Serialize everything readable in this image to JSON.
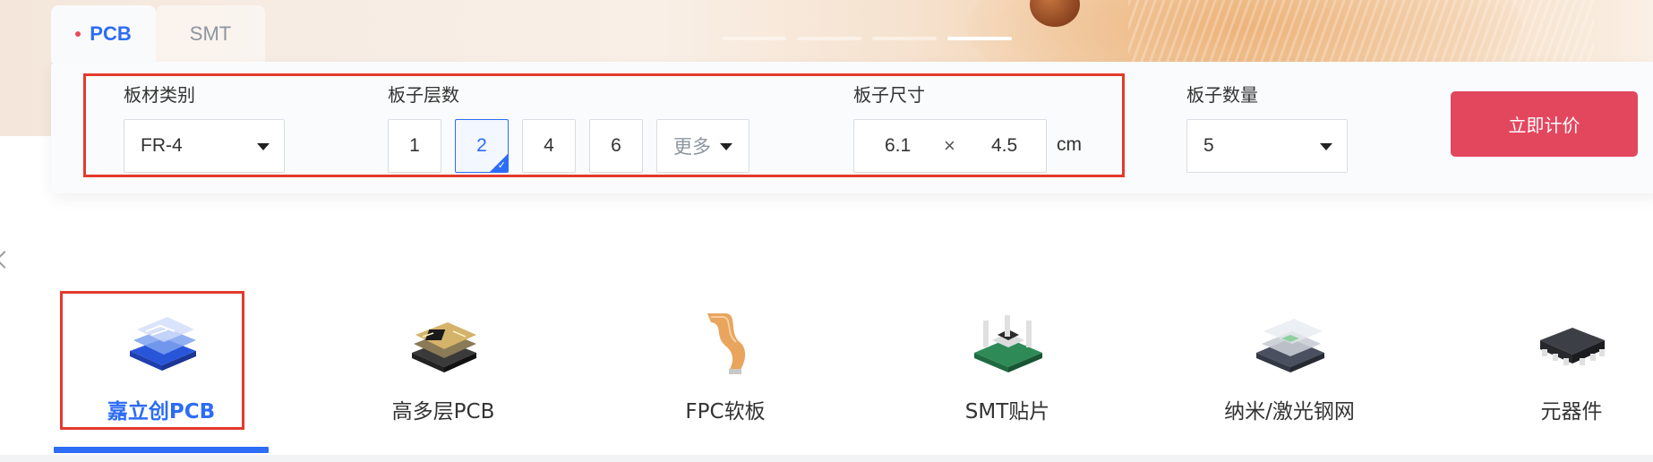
{
  "tabs": [
    {
      "label": "PCB",
      "active": true
    },
    {
      "label": "SMT",
      "active": false
    }
  ],
  "quote": {
    "board_type": {
      "label": "板材类别",
      "value": "FR-4"
    },
    "layers": {
      "label": "板子层数",
      "options": [
        "1",
        "2",
        "4",
        "6"
      ],
      "selected": "2",
      "more_label": "更多"
    },
    "size": {
      "label": "板子尺寸",
      "width": "6.1",
      "times": "×",
      "height": "4.5",
      "unit": "cm"
    },
    "quantity": {
      "label": "板子数量",
      "value": "5"
    },
    "submit_label": "立即计价"
  },
  "categories": [
    {
      "label": "嘉立创PCB",
      "active": true,
      "icon": "pcb-board-icon"
    },
    {
      "label": "高多层PCB",
      "active": false,
      "icon": "multilayer-pcb-icon"
    },
    {
      "label": "FPC软板",
      "active": false,
      "icon": "flexible-cable-icon"
    },
    {
      "label": "SMT贴片",
      "active": false,
      "icon": "smt-chip-icon"
    },
    {
      "label": "纳米/激光钢网",
      "active": false,
      "icon": "stencil-icon"
    },
    {
      "label": "元器件",
      "active": false,
      "icon": "component-chip-icon"
    }
  ],
  "colors": {
    "accent": "#2d6cf5",
    "button": "#e3475e",
    "highlight_frame": "#e33a2c"
  }
}
